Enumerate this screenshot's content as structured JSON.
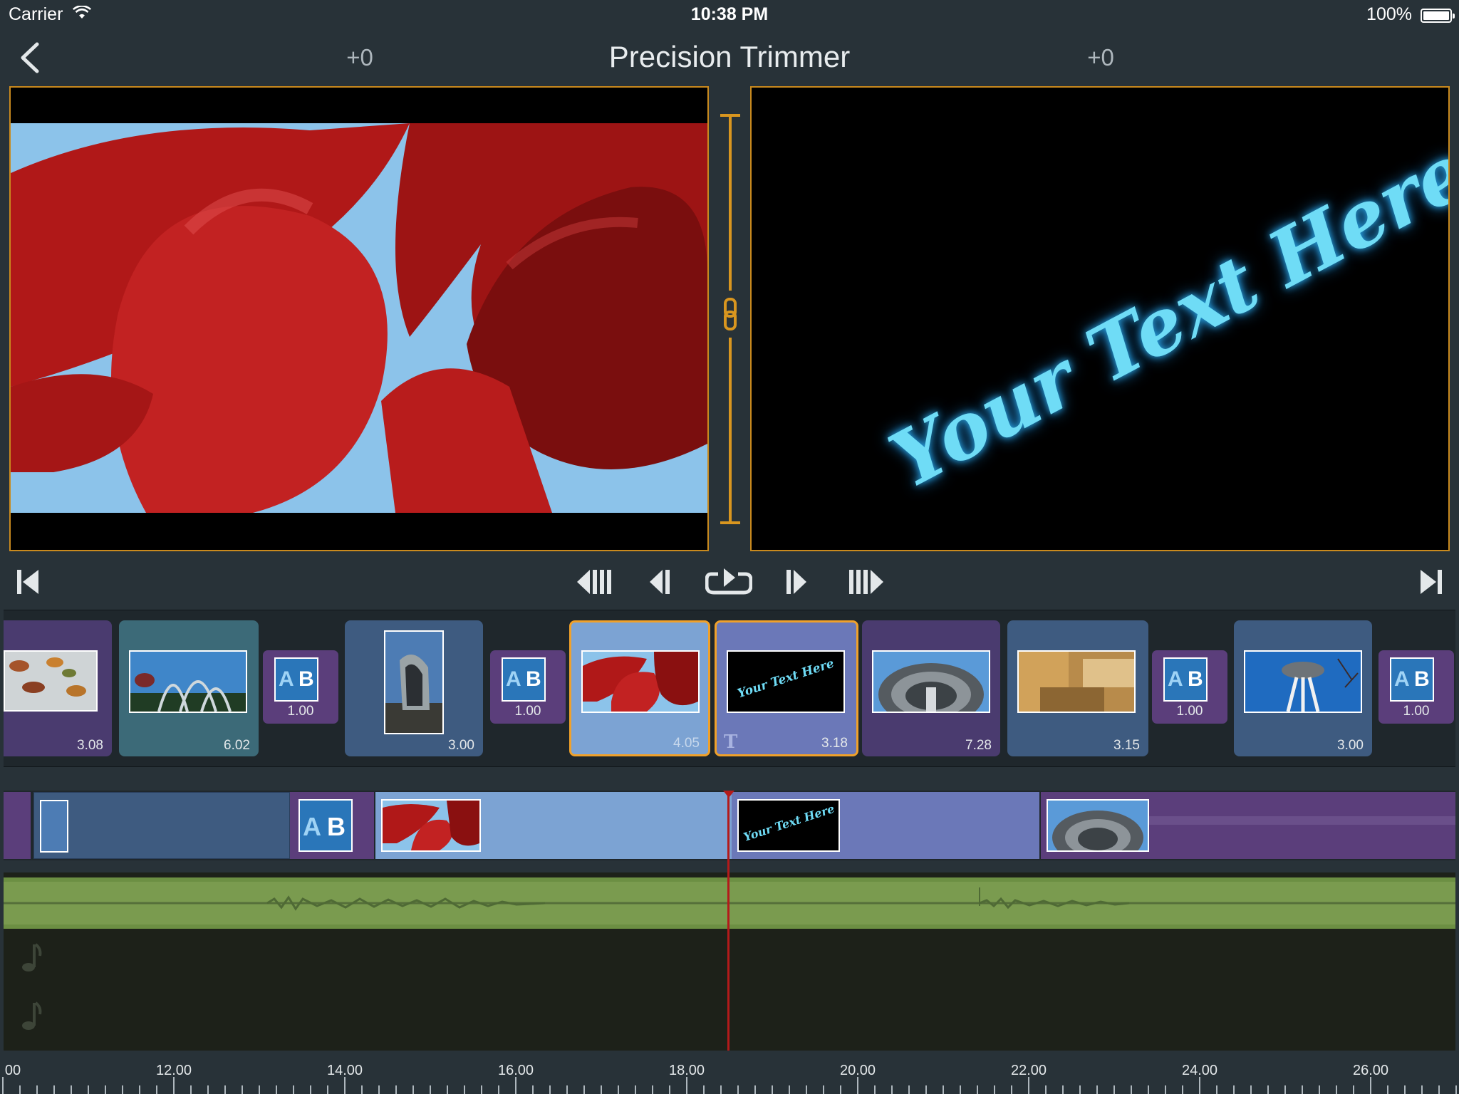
{
  "status_bar": {
    "carrier": "Carrier",
    "time": "10:38 PM",
    "battery": "100%"
  },
  "nav": {
    "title": "Precision Trimmer",
    "offset_left": "+0",
    "offset_right": "+0"
  },
  "preview_right": {
    "overlay_text": "Your Text Here"
  },
  "storyboard": {
    "clips": [
      {
        "kind": "video",
        "duration": "3.08",
        "color": "#4a3b6f",
        "thumb": "autumn-leaves"
      },
      {
        "kind": "video",
        "duration": "6.02",
        "color": "#3c6a78",
        "thumb": "fountain-arches"
      },
      {
        "kind": "transition",
        "duration": "1.00",
        "label_a": "A",
        "label_b": "B"
      },
      {
        "kind": "video",
        "duration": "3.00",
        "color": "#3e5b80",
        "thumb": "metal-sculpture"
      },
      {
        "kind": "transition",
        "duration": "1.00",
        "label_a": "A",
        "label_b": "B"
      },
      {
        "kind": "video",
        "duration": "4.05",
        "color": "#7ca3d3",
        "thumb": "red-sculpture",
        "selected": true
      },
      {
        "kind": "title",
        "duration": "3.18",
        "color": "#6b78b8",
        "thumb": "your-text-here",
        "selected": true,
        "thumb_text": "Your Text Here",
        "badge": "T"
      },
      {
        "kind": "video",
        "duration": "7.28",
        "color": "#4a3b6f",
        "thumb": "space-needle"
      },
      {
        "kind": "video",
        "duration": "3.15",
        "color": "#3e5b80",
        "thumb": "golden-abstract"
      },
      {
        "kind": "transition",
        "duration": "1.00",
        "label_a": "A",
        "label_b": "B"
      },
      {
        "kind": "video",
        "duration": "3.00",
        "color": "#3e5b80",
        "thumb": "space-needle-below"
      },
      {
        "kind": "transition",
        "duration": "1.00",
        "label_a": "A",
        "label_b": "B"
      }
    ]
  },
  "timeline": {
    "title_thumb_text": "Your Text Here",
    "transition_a": "A",
    "transition_b": "B",
    "ruler_labels": [
      "00",
      "12.00",
      "14.00",
      "16.00",
      "18.00",
      "20.00",
      "22.00",
      "24.00",
      "26.00"
    ]
  },
  "colors": {
    "accent": "#f0a12a",
    "background": "#283238",
    "playhead": "#b31a1a",
    "audio": "#6c8f43"
  }
}
